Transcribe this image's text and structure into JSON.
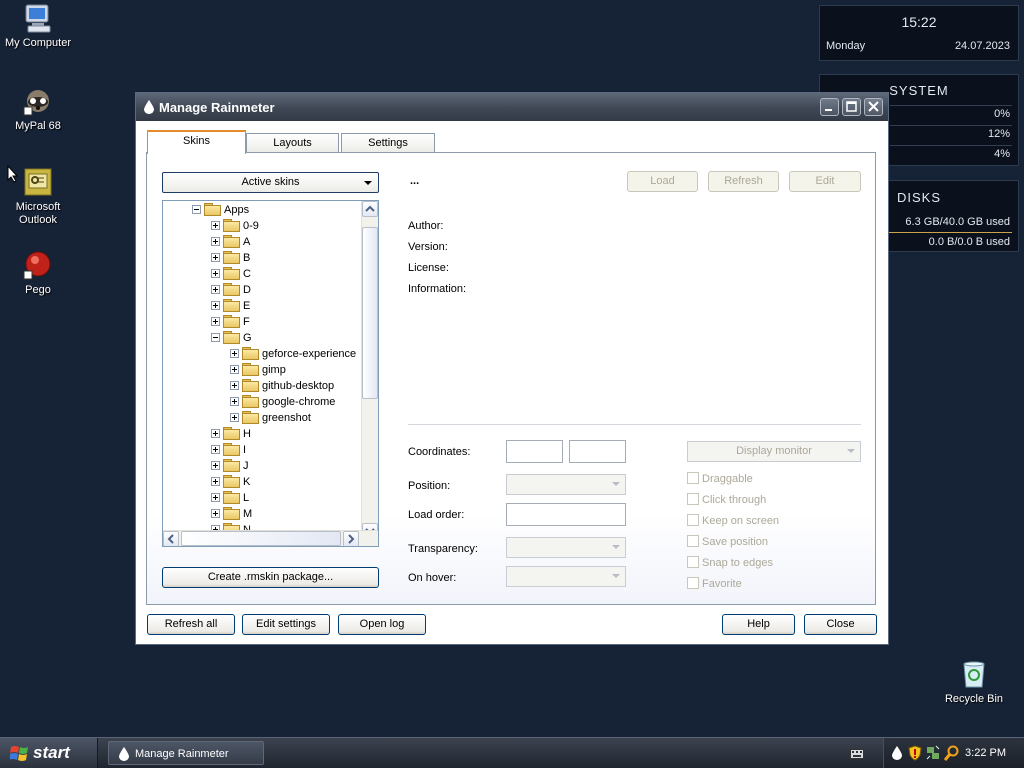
{
  "desktop": {
    "icons": [
      {
        "label": "My Computer"
      },
      {
        "label": "MyPal 68"
      },
      {
        "label": "Microsoft Outlook"
      },
      {
        "label": "Pego"
      },
      {
        "label": "Recycle Bin"
      }
    ]
  },
  "widgets": {
    "clock": {
      "time": "15:22",
      "day": "Monday",
      "date": "24.07.2023"
    },
    "system": {
      "title": "SYSTEM",
      "values": [
        "0%",
        "12%",
        "4%"
      ]
    },
    "disks": {
      "title": "DISKS",
      "values": [
        "6.3 GB/40.0 GB used",
        "0.0 B/0.0 B used"
      ]
    }
  },
  "window": {
    "title": "Manage Rainmeter",
    "tabs": [
      "Skins",
      "Layouts",
      "Settings"
    ],
    "active_tab": "Skins",
    "active_skins_label": "Active skins",
    "tree": [
      {
        "label": "Apps",
        "level": 0,
        "state": "expanded"
      },
      {
        "label": "0-9",
        "level": 1,
        "state": "collapsed"
      },
      {
        "label": "A",
        "level": 1,
        "state": "collapsed"
      },
      {
        "label": "B",
        "level": 1,
        "state": "collapsed"
      },
      {
        "label": "C",
        "level": 1,
        "state": "collapsed"
      },
      {
        "label": "D",
        "level": 1,
        "state": "collapsed"
      },
      {
        "label": "E",
        "level": 1,
        "state": "collapsed"
      },
      {
        "label": "F",
        "level": 1,
        "state": "collapsed"
      },
      {
        "label": "G",
        "level": 1,
        "state": "expanded"
      },
      {
        "label": "geforce-experience",
        "level": 2,
        "state": "collapsed"
      },
      {
        "label": "gimp",
        "level": 2,
        "state": "collapsed"
      },
      {
        "label": "github-desktop",
        "level": 2,
        "state": "collapsed"
      },
      {
        "label": "google-chrome",
        "level": 2,
        "state": "collapsed"
      },
      {
        "label": "greenshot",
        "level": 2,
        "state": "collapsed"
      },
      {
        "label": "H",
        "level": 1,
        "state": "collapsed"
      },
      {
        "label": "I",
        "level": 1,
        "state": "collapsed"
      },
      {
        "label": "J",
        "level": 1,
        "state": "collapsed"
      },
      {
        "label": "K",
        "level": 1,
        "state": "collapsed"
      },
      {
        "label": "L",
        "level": 1,
        "state": "collapsed"
      },
      {
        "label": "M",
        "level": 1,
        "state": "collapsed"
      },
      {
        "label": "N",
        "level": 1,
        "state": "collapsed"
      }
    ],
    "create_package_label": "Create .rmskin package...",
    "skin_name": "...",
    "actions": {
      "load": "Load",
      "refresh": "Refresh",
      "edit": "Edit"
    },
    "meta": {
      "author": "Author:",
      "version": "Version:",
      "license": "License:",
      "information": "Information:"
    },
    "settings": {
      "coordinates": "Coordinates:",
      "position": "Position:",
      "load_order": "Load order:",
      "transparency": "Transparency:",
      "on_hover": "On hover:",
      "display_monitor": "Display monitor",
      "checkboxes": [
        "Draggable",
        "Click through",
        "Keep on screen",
        "Save position",
        "Snap to edges",
        "Favorite"
      ]
    },
    "footer": {
      "refresh_all": "Refresh all",
      "edit_settings": "Edit settings",
      "open_log": "Open log",
      "help": "Help",
      "close": "Close"
    }
  },
  "taskbar": {
    "start_label": "start",
    "task_label": "Manage Rainmeter",
    "clock": "3:22 PM"
  },
  "colors": {
    "desktop_bg": "#162236",
    "tab_accent": "#e68b2c",
    "button_border": "#003c74"
  }
}
